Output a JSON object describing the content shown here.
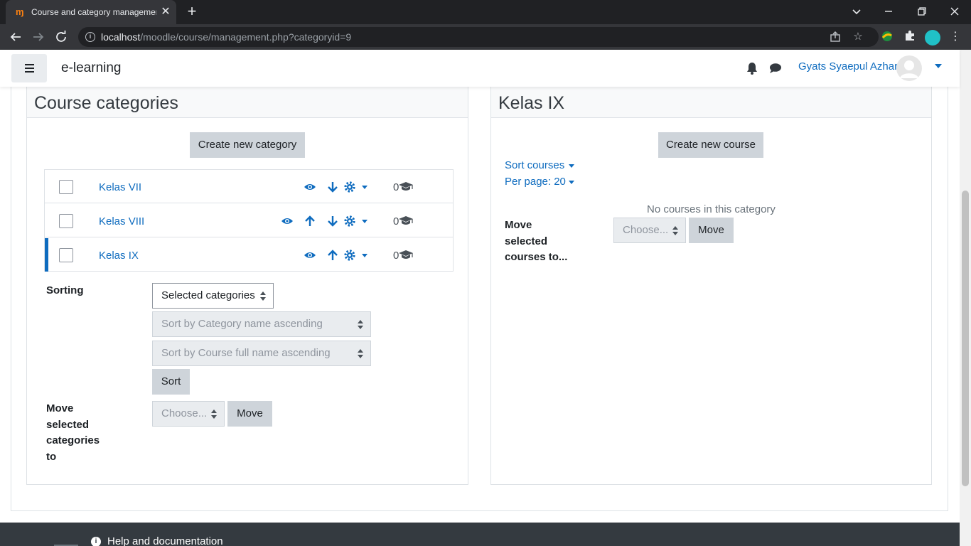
{
  "browser": {
    "tab_title": "Course and category management",
    "tab_favicon": "moodle-favicon",
    "tab_close_glyph": "✕",
    "new_tab_glyph": "+",
    "url_host": "localhost",
    "url_path": "/moodle/course/management.php?categoryid=9",
    "icons": [
      "back-icon",
      "forward-icon",
      "reload-icon",
      "site-info-icon",
      "share-icon",
      "bookmark-star-icon",
      "extension-icon",
      "puzzle-icon",
      "profile-icon",
      "menu-kebab-icon",
      "minimize-icon",
      "restore-icon",
      "close-window-icon",
      "tab-search-icon"
    ]
  },
  "navbar": {
    "brand": "e-learning",
    "user_name": "Gyats Syaepul Azhar",
    "icons": [
      "hamburger-icon",
      "bell-icon",
      "chat-icon",
      "user-avatar",
      "caret-down-icon"
    ]
  },
  "categories_panel": {
    "title": "Course categories",
    "create_button": "Create new category",
    "rows": [
      {
        "name": "Kelas VII",
        "count": "0",
        "active": false
      },
      {
        "name": "Kelas VIII",
        "count": "0",
        "active": false
      },
      {
        "name": "Kelas IX",
        "count": "0",
        "active": true
      }
    ],
    "sorting_label": "Sorting",
    "sorting_select": "Selected categories",
    "sort_category_select": "Sort by Category name ascending",
    "sort_course_select": "Sort by Course full name ascending",
    "sort_button": "Sort",
    "move_label": "Move selected categories to",
    "move_select": "Choose...",
    "move_button": "Move"
  },
  "courses_panel": {
    "title": "Kelas IX",
    "create_button": "Create new course",
    "sort_courses_link": "Sort courses",
    "per_page_link": "Per page: 20",
    "empty_message": "No courses in this category",
    "move_label": "Move selected courses to...",
    "move_select": "Choose...",
    "move_button": "Move"
  },
  "footer": {
    "help_text": "Help and documentation"
  },
  "colors": {
    "link": "#0f6cbf",
    "button_secondary": "#ced4da",
    "chrome_dark": "#202124",
    "chrome_toolbar": "#35363a",
    "footer": "#343a40"
  }
}
